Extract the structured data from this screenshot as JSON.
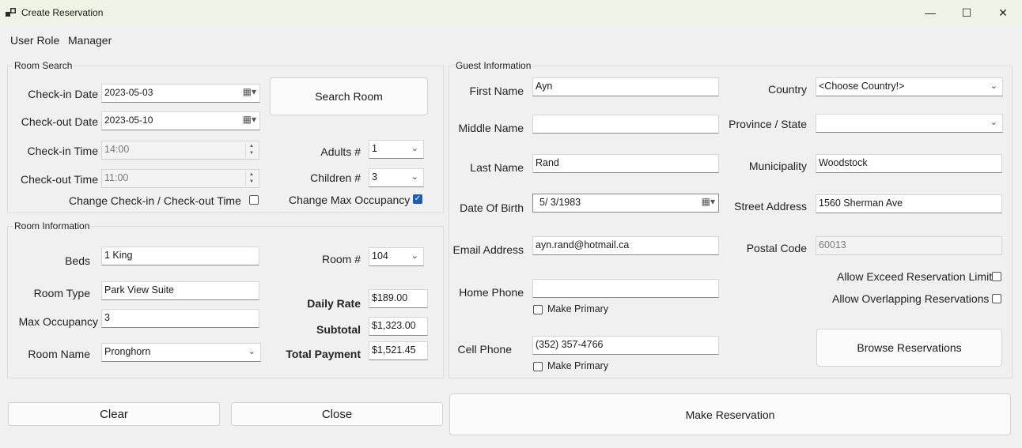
{
  "window": {
    "title": "Create Reservation",
    "minimize_glyph": "—",
    "maximize_glyph": "☐",
    "close_glyph": "✕"
  },
  "user": {
    "role_label": "User Role",
    "role_value": "Manager"
  },
  "room_search": {
    "group_title": "Room Search",
    "checkin_date_label": "Check-in Date",
    "checkin_date_value": "2023-05-03",
    "checkout_date_label": "Check-out Date",
    "checkout_date_value": "2023-05-10",
    "checkin_time_label": "Check-in Time",
    "checkin_time_value": "14:00",
    "checkout_time_label": "Check-out Time",
    "checkout_time_value": "11:00",
    "search_button": "Search Room",
    "adults_label": "Adults #",
    "adults_value": "1",
    "children_label": "Children #",
    "children_value": "3",
    "change_time_label": "Change Check-in /  Check-out Time",
    "change_time_checked": false,
    "change_occupancy_label": "Change Max Occupancy",
    "change_occupancy_checked": true
  },
  "room_info": {
    "group_title": "Room Information",
    "beds_label": "Beds",
    "beds_value": "1 King",
    "room_type_label": "Room Type",
    "room_type_value": "Park View Suite",
    "max_occupancy_label": "Max Occupancy",
    "max_occupancy_value": "3",
    "room_name_label": "Room Name",
    "room_name_value": "Pronghorn",
    "room_number_label": "Room #",
    "room_number_value": "104",
    "daily_rate_label": "Daily Rate",
    "daily_rate_value": "$189.00",
    "subtotal_label": "Subtotal",
    "subtotal_value": "$1,323.00",
    "total_label": "Total Payment",
    "total_value": "$1,521.45"
  },
  "guest": {
    "group_title": "Guest Information",
    "first_name_label": "First Name",
    "first_name_value": "Ayn",
    "middle_name_label": "Middle Name",
    "middle_name_value": "",
    "last_name_label": "Last Name",
    "last_name_value": "Rand",
    "dob_label": "Date Of Birth",
    "dob_value": "5/  3/1983",
    "email_label": "Email Address",
    "email_value": "ayn.rand@hotmail.ca",
    "home_phone_label": "Home Phone",
    "home_phone_value": "",
    "home_primary_label": "Make Primary",
    "home_primary_checked": false,
    "cell_phone_label": "Cell Phone",
    "cell_phone_value": "(352) 357-4766",
    "cell_primary_label": "Make Primary",
    "cell_primary_checked": false,
    "country_label": "Country",
    "country_value": "<Choose Country!>",
    "province_label": "Province / State",
    "province_value": "",
    "municipality_label": "Municipality",
    "municipality_value": "Woodstock",
    "street_label": "Street Address",
    "street_value": "1560 Sherman Ave",
    "postal_label": "Postal Code",
    "postal_value": "60013",
    "exceed_limit_label": "Allow Exceed Reservation Limit",
    "exceed_limit_checked": false,
    "overlap_label": "Allow Overlapping Reservations",
    "overlap_checked": false,
    "browse_button": "Browse Reservations"
  },
  "actions": {
    "clear_button": "Clear",
    "close_button": "Close",
    "make_button": "Make Reservation"
  },
  "icons": {
    "combo_arrow": "⌄",
    "calendar": "▦▾",
    "spin": "▲▼",
    "check": "✓"
  },
  "colors": {
    "accent": "#1a5fb4",
    "titlebar": "#eef5e6"
  }
}
